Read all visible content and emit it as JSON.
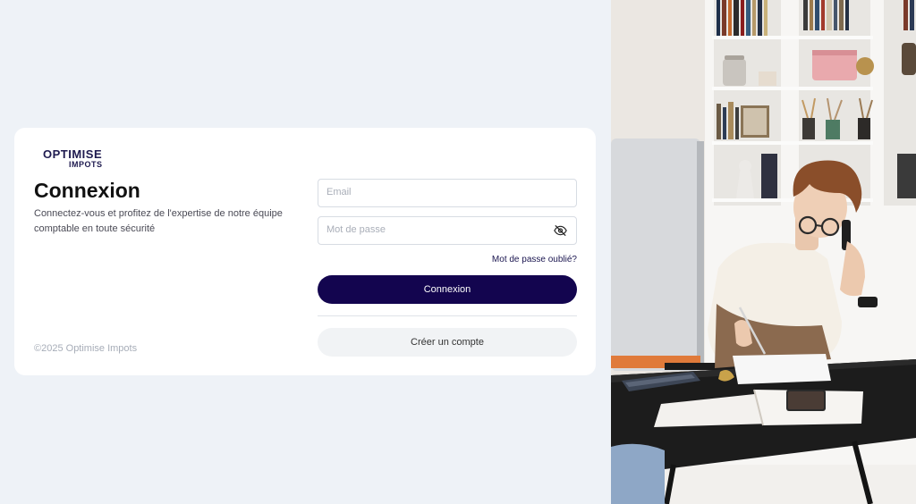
{
  "brand": {
    "logo_line1": "OPTIMISE",
    "logo_line2": "IMPOTS"
  },
  "login": {
    "title": "Connexion",
    "subtitle": "Connectez-vous et profitez de l'expertise de notre équipe comptable en toute sécurité",
    "email_placeholder": "Email",
    "email_value": "",
    "password_placeholder": "Mot de passe",
    "password_value": "",
    "forgot_label": "Mot de passe oublié?",
    "submit_label": "Connexion",
    "create_account_label": "Créer un compte"
  },
  "footer": {
    "copyright": "©2025 Optimise Impots"
  },
  "icons": {
    "password_toggle": "eye-off-icon"
  },
  "colors": {
    "primary": "#13054f",
    "background": "#eef2f7",
    "card": "#ffffff",
    "secondary_button": "#f1f3f5"
  }
}
